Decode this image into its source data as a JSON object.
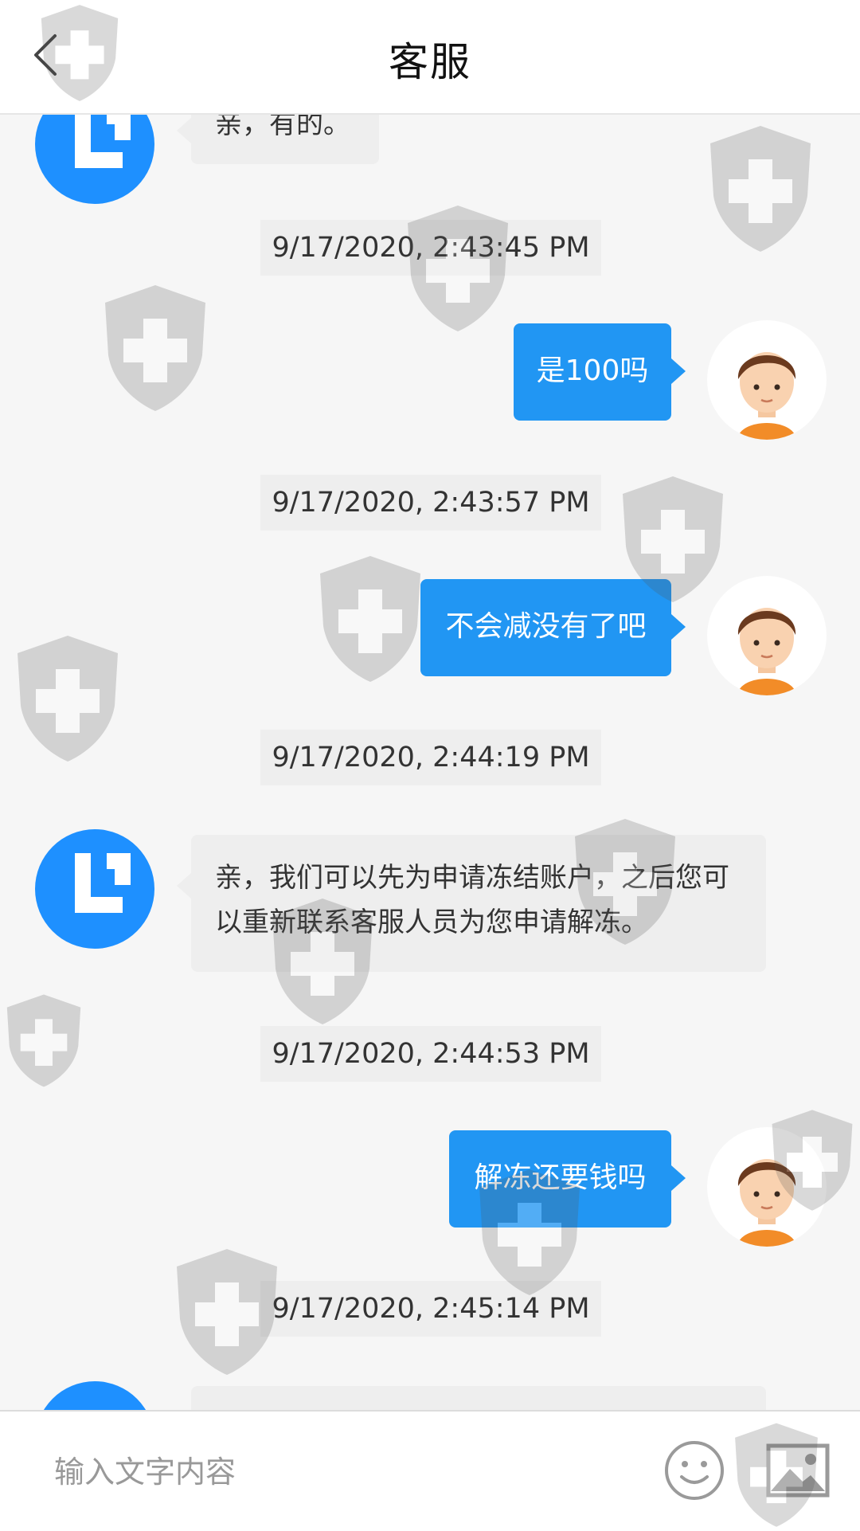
{
  "header": {
    "title": "客服",
    "back_icon": "chevron-left-icon"
  },
  "messages": [
    {
      "from": "agent",
      "text": "亲，有的。"
    },
    {
      "timestamp": "9/17/2020, 2:43:45 PM"
    },
    {
      "from": "user",
      "text": "是100吗"
    },
    {
      "timestamp": "9/17/2020, 2:43:57 PM"
    },
    {
      "from": "user",
      "text": "不会减没有了吧"
    },
    {
      "timestamp": "9/17/2020, 2:44:19 PM"
    },
    {
      "from": "agent",
      "text": "亲，我们可以先为申请冻结账户，之后您可以重新联系客服人员为您申请解冻。"
    },
    {
      "timestamp": "9/17/2020, 2:44:53 PM"
    },
    {
      "from": "user",
      "text": "解冻还要钱吗"
    },
    {
      "timestamp": "9/17/2020, 2:45:14 PM"
    }
  ],
  "footer": {
    "input_placeholder": "输入文字内容",
    "emoji_icon": "smiley-icon",
    "image_icon": "image-icon"
  },
  "colors": {
    "accent": "#2196f3",
    "agent_avatar": "#1e90ff",
    "background": "#f6f6f6"
  }
}
